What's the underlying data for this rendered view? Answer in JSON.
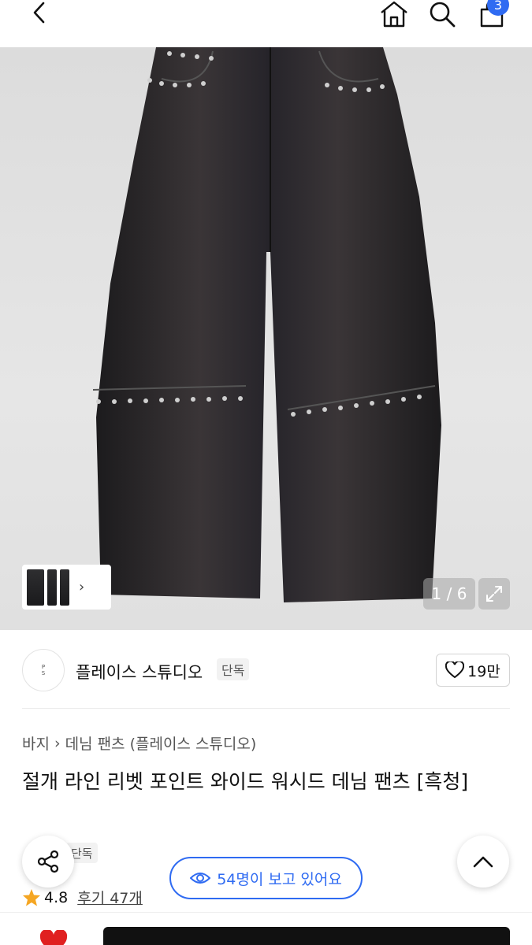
{
  "header": {
    "cart_count": "3"
  },
  "gallery": {
    "counter": "1 / 6"
  },
  "shop": {
    "name": "플레이스 스튜디오",
    "exclusive": "단독",
    "likes": "19만"
  },
  "breadcrumb": {
    "category": "바지",
    "subcategory": "데님 팬츠 (플레이스 스튜디오)"
  },
  "product": {
    "title": "절개 라인 리벳 포인트 와이드 워시드 데님 팬츠 [흑청]",
    "tag": "단독",
    "rating": "4.8",
    "reviews": "후기 47개"
  },
  "viewing": {
    "text": "54명이 보고 있어요"
  },
  "colors": {
    "accent": "#2f6bf2",
    "star": "#f5a623",
    "heart": "#e02020"
  }
}
